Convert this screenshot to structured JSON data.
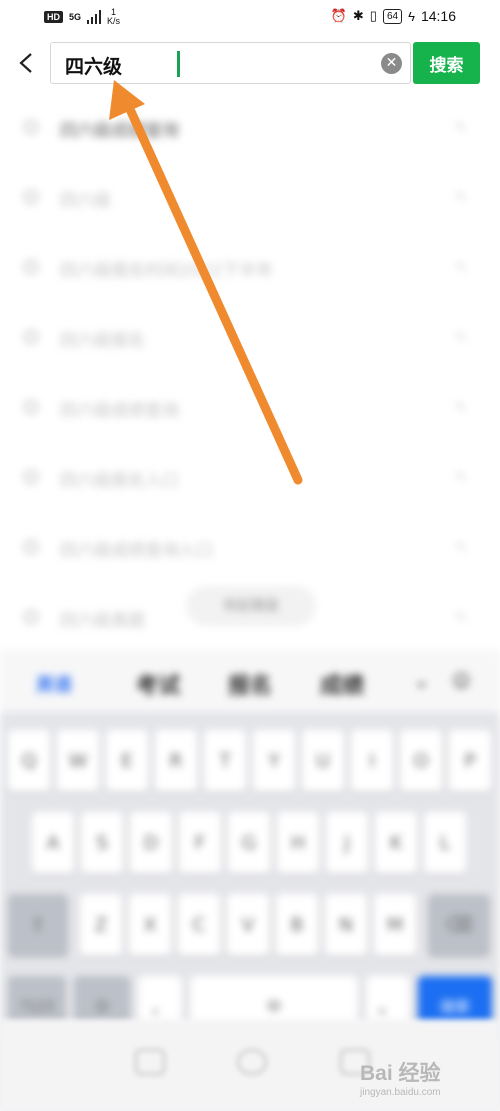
{
  "status_bar": {
    "hd": "HD",
    "network": "5G",
    "net_speed_value": "1",
    "net_speed_unit": "K/s",
    "battery": "64",
    "time": "14:16"
  },
  "search": {
    "query": "四六级",
    "button_label": "搜索"
  },
  "suggestions": [
    "四六级成绩查询",
    "四六级",
    "四六级报名时间2022下半年",
    "四六级报名",
    "四六级成绩查询",
    "四六级报名入口",
    "四六级成绩查询入口",
    "四六级真题"
  ],
  "floating_pill": "收起键盘",
  "keyboard": {
    "candidates": [
      "英语",
      "考试",
      "报名",
      "成绩"
    ],
    "row1": [
      "Q",
      "W",
      "E",
      "R",
      "T",
      "Y",
      "U",
      "I",
      "O",
      "P"
    ],
    "row2": [
      "A",
      "S",
      "D",
      "F",
      "G",
      "H",
      "J",
      "K",
      "L"
    ],
    "row3": [
      "Z",
      "X",
      "C",
      "V",
      "B",
      "N",
      "M"
    ],
    "space_label": "中",
    "enter_label": "搜索"
  },
  "watermark": {
    "main": "Bai 经验",
    "sub": "jingyan.baidu.com"
  },
  "colors": {
    "accent_green": "#16b24b",
    "caret_green": "#1aa154",
    "annotation_orange": "#f08a2e",
    "keyboard_blue": "#1c6ff2"
  }
}
